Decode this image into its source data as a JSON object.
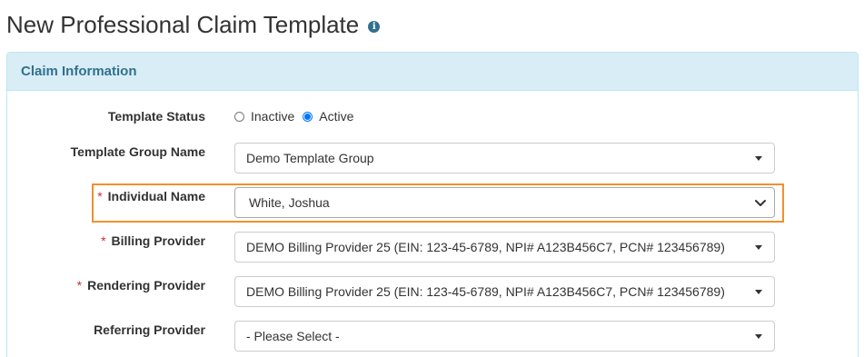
{
  "page": {
    "title": "New Professional Claim Template",
    "info_icon": "info-circle-icon"
  },
  "panel": {
    "title": "Claim Information"
  },
  "form": {
    "template_status": {
      "label": "Template Status",
      "options": [
        "Inactive",
        "Active"
      ],
      "selected": "Active"
    },
    "template_group_name": {
      "label": "Template Group Name",
      "value": "Demo Template Group"
    },
    "individual_name": {
      "label": "Individual Name",
      "required_marker": "*",
      "value": "White, Joshua"
    },
    "billing_provider": {
      "label": "Billing Provider",
      "required_marker": "*",
      "value": "DEMO Billing Provider 25 (EIN: 123-45-6789, NPI# A123B456C7, PCN# 123456789)"
    },
    "rendering_provider": {
      "label": "Rendering Provider",
      "required_marker": "*",
      "value": "DEMO Billing Provider 25 (EIN: 123-45-6789, NPI# A123B456C7, PCN# 123456789)"
    },
    "referring_provider": {
      "label": "Referring Provider",
      "value": "- Please Select -"
    }
  },
  "colors": {
    "panel_heading_bg": "#d9edf7",
    "panel_title": "#31708f",
    "highlight_border": "#f0902e",
    "required_marker": "#c9302c",
    "radio_accent": "#0075ff"
  }
}
